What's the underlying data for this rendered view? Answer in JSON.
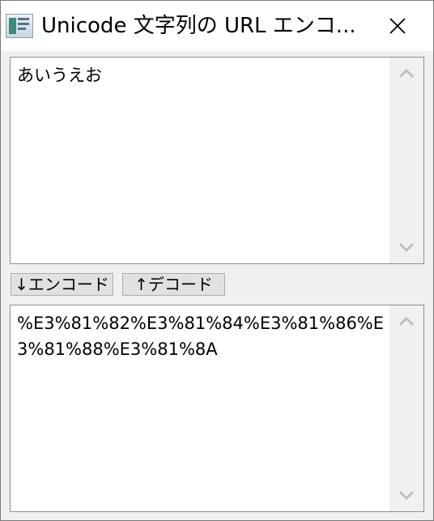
{
  "window": {
    "title": "Unicode 文字列の URL エンコ...",
    "close_icon": "close-icon"
  },
  "input": {
    "text": "あいうえお"
  },
  "output": {
    "text": "%E3%81%82%E3%81%84%E3%81%86%E3%81%88%E3%81%8A"
  },
  "buttons": {
    "encode_label": "↓エンコード",
    "decode_label": "↑デコード"
  },
  "colors": {
    "chrome": "#f0f0f0",
    "button_face": "#e1e1e1",
    "border": "#8c8c8c",
    "scroll_arrow": "#c0c0c0"
  }
}
